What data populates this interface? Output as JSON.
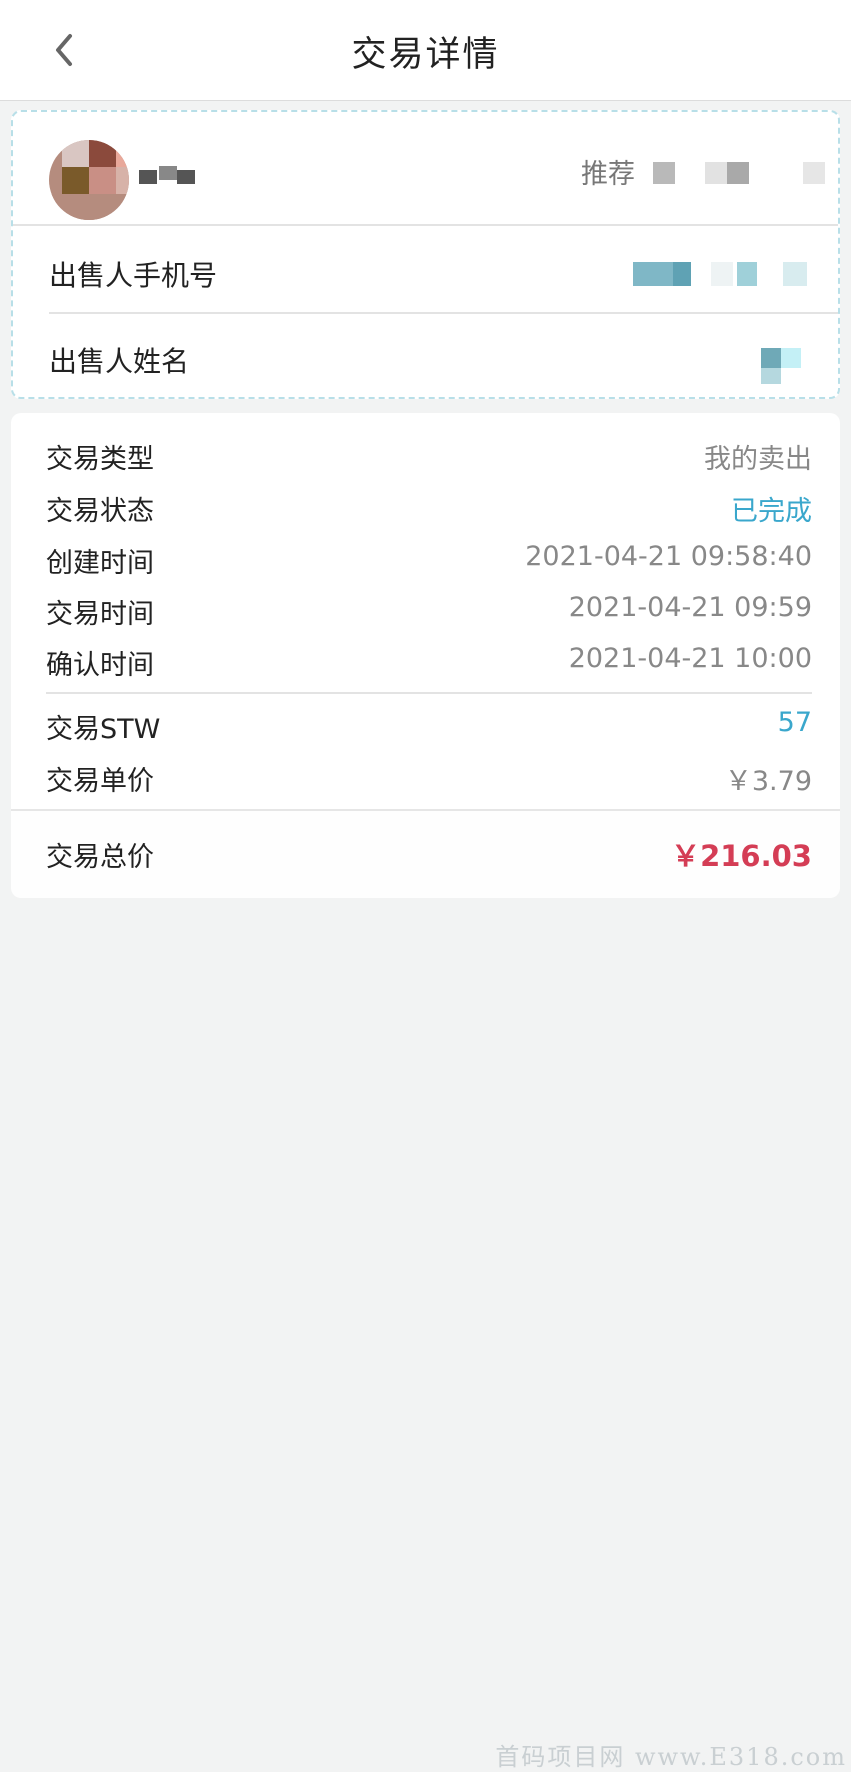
{
  "header": {
    "title": "交易详情",
    "back_icon": "chevron-left-icon"
  },
  "seller": {
    "referrer_label": "推荐",
    "phone_label": "出售人手机号",
    "name_label": "出售人姓名"
  },
  "details": {
    "rows": [
      {
        "label": "交易类型",
        "value": "我的卖出"
      },
      {
        "label": "交易状态",
        "value": "已完成"
      },
      {
        "label": "创建时间",
        "value": "2021-04-21 09:58:40"
      },
      {
        "label": "交易时间",
        "value": "2021-04-21 09:59"
      },
      {
        "label": "确认时间",
        "value": "2021-04-21 10:00"
      }
    ],
    "stw_label": "交易STW",
    "stw_value": "57",
    "unit_price_label": "交易单价",
    "unit_price_value": "￥3.79",
    "total_label": "交易总价",
    "total_value": "￥216.03"
  },
  "colors": {
    "accent_blue": "#3aa7cc",
    "total_red": "#d43d55",
    "background": "#f2f3f3"
  },
  "watermark": "首码项目网 www.E318.com"
}
